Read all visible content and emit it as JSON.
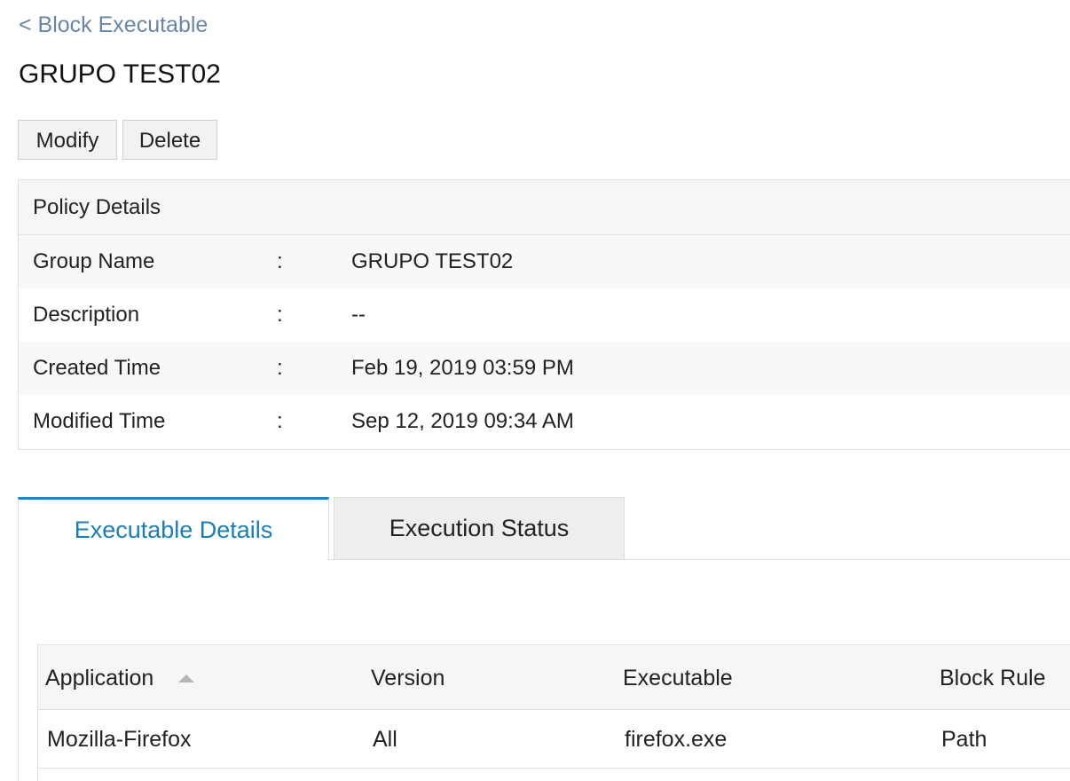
{
  "breadcrumb": {
    "back_label": "< Block Executable"
  },
  "page": {
    "title": "GRUPO TEST02"
  },
  "actions": {
    "modify_label": "Modify",
    "delete_label": "Delete"
  },
  "policy_details": {
    "header": "Policy Details",
    "rows": [
      {
        "label": "Group Name",
        "separator": ":",
        "value": "GRUPO TEST02"
      },
      {
        "label": "Description",
        "separator": ":",
        "value": "--"
      },
      {
        "label": "Created Time",
        "separator": ":",
        "value": "Feb 19, 2019 03:59 PM"
      },
      {
        "label": "Modified Time",
        "separator": ":",
        "value": "Sep 12, 2019 09:34 AM"
      }
    ]
  },
  "tabs": [
    {
      "label": "Executable Details",
      "active": true
    },
    {
      "label": "Execution Status",
      "active": false
    }
  ],
  "table": {
    "columns": [
      "Application",
      "Version",
      "Executable",
      "Block Rule"
    ],
    "sort_icon": "sort-ascending-icon",
    "rows": [
      [
        "Mozilla-Firefox",
        "All",
        "firefox.exe",
        "Path"
      ]
    ]
  },
  "colors": {
    "accent": "#1b88c4",
    "link": "#6b85a6"
  }
}
